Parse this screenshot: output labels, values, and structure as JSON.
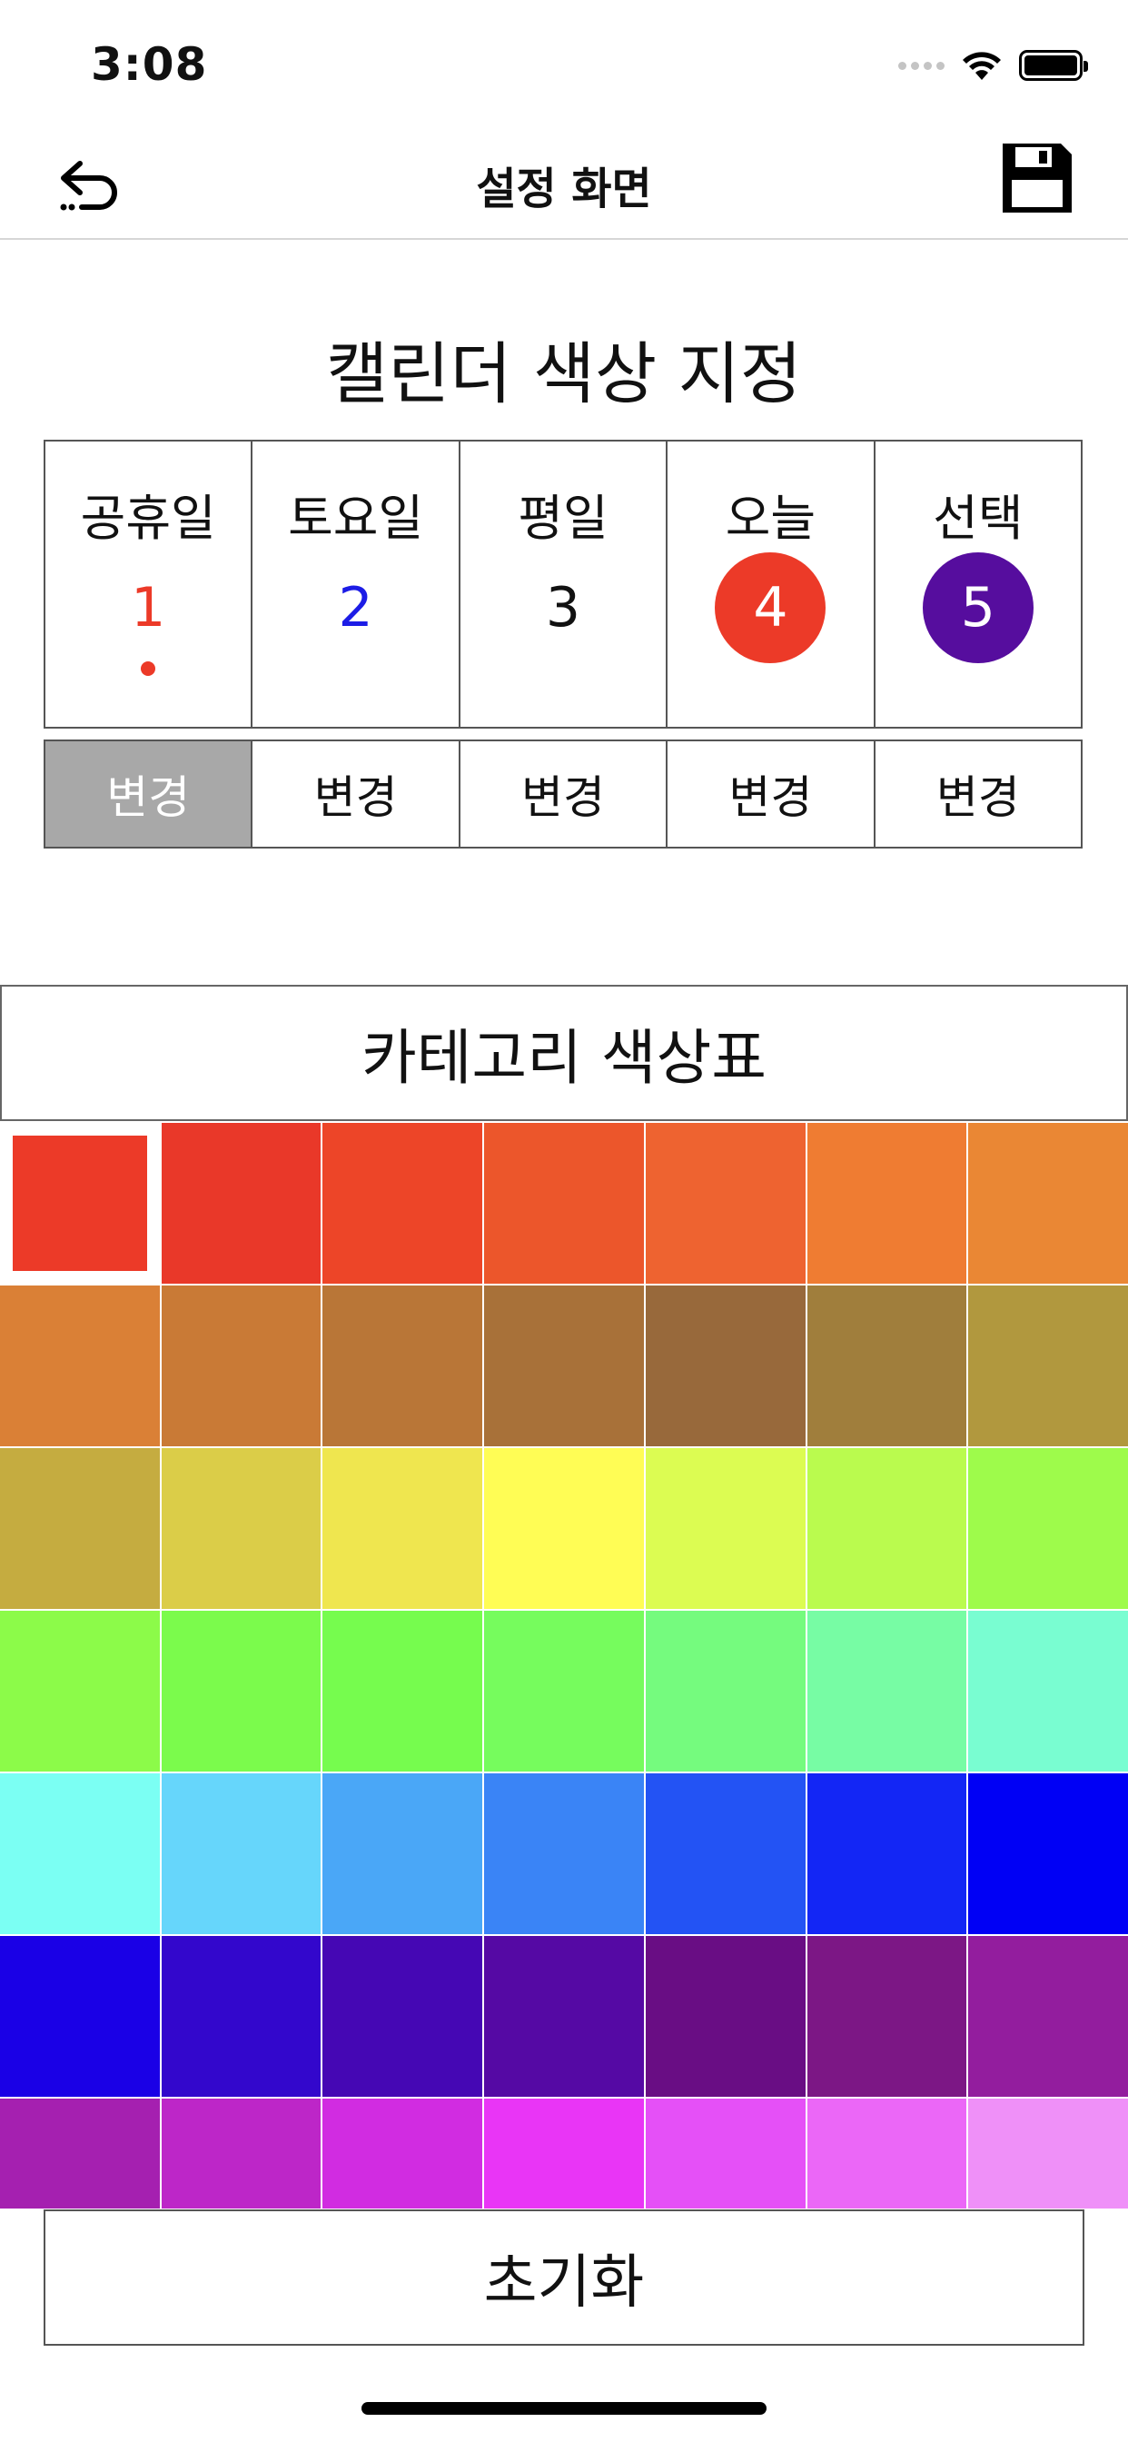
{
  "status_bar": {
    "time": "3:08",
    "icons": [
      "cellular-signal-icon",
      "wifi-icon",
      "battery-icon"
    ]
  },
  "nav": {
    "title": "설정 화면",
    "back_icon": "undo-arrow-icon",
    "save_icon": "floppy-disk-icon"
  },
  "calendar": {
    "title": "캘린더 색상 지정",
    "day_types": [
      {
        "label": "공휴일",
        "number": "1",
        "color": "#ec3a28",
        "style": "text",
        "dot": true
      },
      {
        "label": "토요일",
        "number": "2",
        "color": "#1c1ce6",
        "style": "text",
        "dot": false
      },
      {
        "label": "평일",
        "number": "3",
        "color": "#111111",
        "style": "text",
        "dot": false
      },
      {
        "label": "오늘",
        "number": "4",
        "color": "#ec3a28",
        "style": "circle",
        "dot": false
      },
      {
        "label": "선택",
        "number": "5",
        "color": "#560d9e",
        "style": "circle",
        "dot": false
      }
    ],
    "change_label": "변경",
    "active_change_index": 0
  },
  "palette": {
    "title": "카테고리 색상표",
    "selected_index": 0,
    "colors": [
      "#ec3a28",
      "#e93829",
      "#ed4528",
      "#ec562b",
      "#ee6330",
      "#ef7c32",
      "#ea8734",
      "#da8036",
      "#c97a36",
      "#b97637",
      "#a87139",
      "#98693b",
      "#a07e3c",
      "#b1983e",
      "#c5ac40",
      "#dbcd48",
      "#efe64f",
      "#fffd55",
      "#dcfc52",
      "#bafb4e",
      "#9efb4b",
      "#8cfb49",
      "#7bfb4c",
      "#76fc4e",
      "#76fc5d",
      "#75fb7e",
      "#77fca4",
      "#79fdd1",
      "#7bfff3",
      "#66d6fb",
      "#4aa7f7",
      "#3a84f6",
      "#2353f4",
      "#1326f5",
      "#0000f5",
      "#1a00e6",
      "#3307cc",
      "#4507b4",
      "#5509a4",
      "#690d84",
      "#7c1785",
      "#931d9e",
      "#a520b0",
      "#bd26c8",
      "#d12ce1",
      "#e935f6",
      "#e550f7",
      "#eb67f7",
      "#ef90f8"
    ]
  },
  "reset_label": "초기화"
}
